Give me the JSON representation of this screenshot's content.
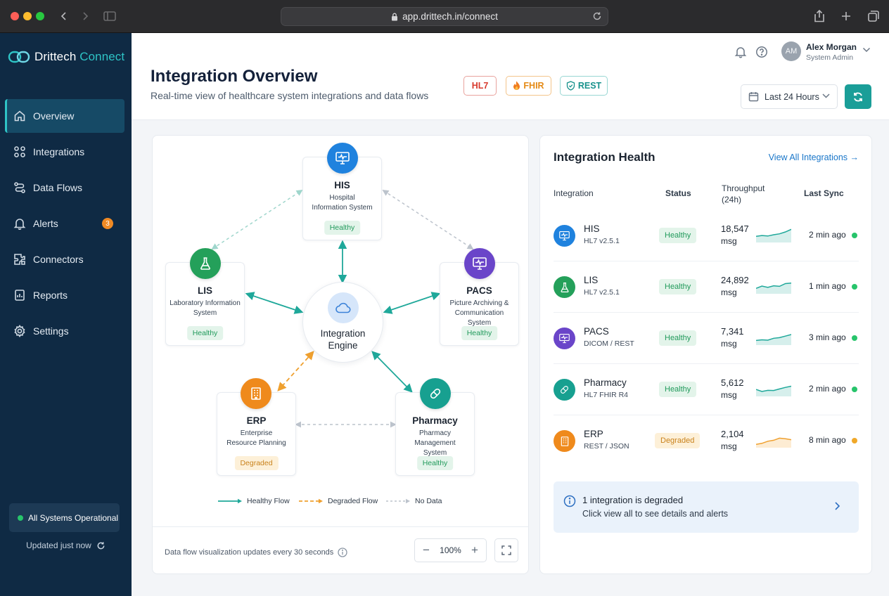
{
  "browser": {
    "url": "app.drittech.in/connect"
  },
  "colors": {
    "sidebar_bg": "#0f2a44",
    "accent": "#2ec4c6",
    "healthy": "#27c46b",
    "degraded": "#f0a829",
    "primary_button": "#1a9e98"
  },
  "brand": {
    "name": "Drittech",
    "accent_word": "Connect"
  },
  "sidebar": {
    "items": [
      {
        "label": "Overview",
        "icon": "home-icon",
        "active": true
      },
      {
        "label": "Integrations",
        "icon": "integrations-icon"
      },
      {
        "label": "Data Flows",
        "icon": "data-flows-icon"
      },
      {
        "label": "Alerts",
        "icon": "bell-icon",
        "badge": "3"
      },
      {
        "label": "Connectors",
        "icon": "connectors-icon"
      },
      {
        "label": "Reports",
        "icon": "reports-icon"
      },
      {
        "label": "Settings",
        "icon": "gear-icon"
      }
    ],
    "system_status": "All Systems Operational",
    "updated": "Updated just now"
  },
  "header": {
    "title": "Integration Overview",
    "subtitle": "Real-time view of healthcare system integrations and data flows",
    "protocols": [
      "HL7",
      "FHIR",
      "REST"
    ],
    "user": {
      "initials": "AM",
      "name": "Alex Morgan",
      "role": "System Admin"
    },
    "time_range": "Last 24 Hours"
  },
  "graph": {
    "engine": {
      "line1": "Integration",
      "line2": "Engine"
    },
    "nodes": {
      "his": {
        "title": "HIS",
        "subtitle": "Hospital Information System",
        "status": "Healthy"
      },
      "lis": {
        "title": "LIS",
        "subtitle": "Laboratory Information System",
        "status": "Healthy"
      },
      "pacs": {
        "title": "PACS",
        "subtitle": "Picture Archiving & Communication System",
        "status": "Healthy"
      },
      "erp": {
        "title": "ERP",
        "subtitle": "Enterprise Resource Planning",
        "status": "Degraded"
      },
      "pharmacy": {
        "title": "Pharmacy",
        "subtitle": "Pharmacy Management System",
        "status": "Healthy"
      }
    },
    "legend": {
      "healthy": "Healthy Flow",
      "degraded": "Degraded Flow",
      "nodata": "No Data"
    },
    "footer_note": "Data flow visualization updates every 30 seconds",
    "zoom": "100%"
  },
  "health": {
    "title": "Integration Health",
    "view_all": "View All Integrations →",
    "columns": {
      "integration": "Integration",
      "status": "Status",
      "throughput": "Throughput",
      "throughput_period": "(24h)",
      "last_sync": "Last Sync"
    },
    "rows": [
      {
        "name": "HIS",
        "protocol": "HL7 v2.5.1",
        "status": "Healthy",
        "count": "18,547",
        "unit": "msg",
        "sync": "2 min ago",
        "trend": [
          4,
          4.5,
          4.2,
          5,
          5.6,
          6.8,
          8.5
        ]
      },
      {
        "name": "LIS",
        "protocol": "HL7 v2.5.1",
        "status": "Healthy",
        "count": "24,892",
        "unit": "msg",
        "sync": "1 min ago",
        "trend": [
          3.5,
          5,
          4.2,
          5.2,
          4.8,
          6.6,
          6.9
        ]
      },
      {
        "name": "PACS",
        "protocol": "DICOM / REST",
        "status": "Healthy",
        "count": "7,341",
        "unit": "msg",
        "sync": "3 min ago",
        "trend": [
          3,
          3.4,
          3.2,
          4.4,
          4.8,
          5.8,
          6.8
        ]
      },
      {
        "name": "Pharmacy",
        "protocol": "HL7 FHIR R4",
        "status": "Healthy",
        "count": "5,612",
        "unit": "msg",
        "sync": "2 min ago",
        "trend": [
          4.5,
          3.2,
          3.9,
          3.8,
          4.8,
          5.8,
          6.6
        ]
      },
      {
        "name": "ERP",
        "protocol": "REST / JSON",
        "status": "Degraded",
        "count": "2,104",
        "unit": "msg",
        "sync": "8 min ago",
        "trend": [
          2.2,
          2.8,
          4.2,
          4.8,
          6.2,
          5.8,
          5.2
        ]
      }
    ],
    "alert": {
      "title": "1 integration is degraded",
      "subtitle": "Click view all to see details and alerts"
    }
  }
}
